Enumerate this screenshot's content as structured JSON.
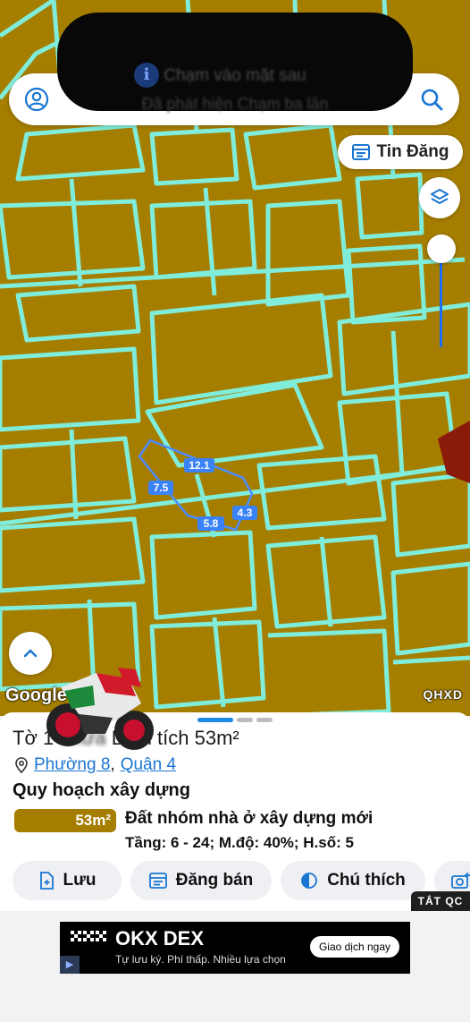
{
  "notification": {
    "line1": "Chạm vào mặt sau",
    "line2": "Đã phát hiện Chạm ba lần"
  },
  "search": {
    "left_icon": "user-circle-icon",
    "right_icon": "search-icon"
  },
  "map": {
    "tin_dang_label": "Tin Đăng",
    "google_label": "Google",
    "layer_label": "QHXD",
    "plot_dimensions": [
      "12.1",
      "7.5",
      "5.8",
      "4.3"
    ],
    "colors": {
      "land": "#a57e00",
      "lines": "#7ff2e6",
      "plot": "#4c8cff"
    }
  },
  "sheet": {
    "title_prefix": "Tờ 1",
    "title_blurred": "Thửa",
    "title_suffix": "Diện tích 53m²",
    "ward": "Phường 8",
    "district": "Quận 4",
    "section_title": "Quy hoạch xây dựng",
    "area_badge": "53m²",
    "land_use": "Đất nhóm nhà ở xây dựng mới",
    "params": "Tầng: 6 - 24; M.độ: 40%; H.số: 5",
    "actions": [
      {
        "label": "Lưu",
        "icon": "add-document-icon"
      },
      {
        "label": "Đăng bán",
        "icon": "calendar-list-icon"
      },
      {
        "label": "Chú thích",
        "icon": "half-circle-icon"
      },
      {
        "label": "",
        "icon": "camera-add-icon"
      }
    ]
  },
  "ad_close_label": "TẮT QC",
  "ad": {
    "brand": "OKX DEX",
    "subtitle": "Tự lưu ký. Phí thấp. Nhiều lựa chọn",
    "cta": "Giao dịch ngay"
  }
}
